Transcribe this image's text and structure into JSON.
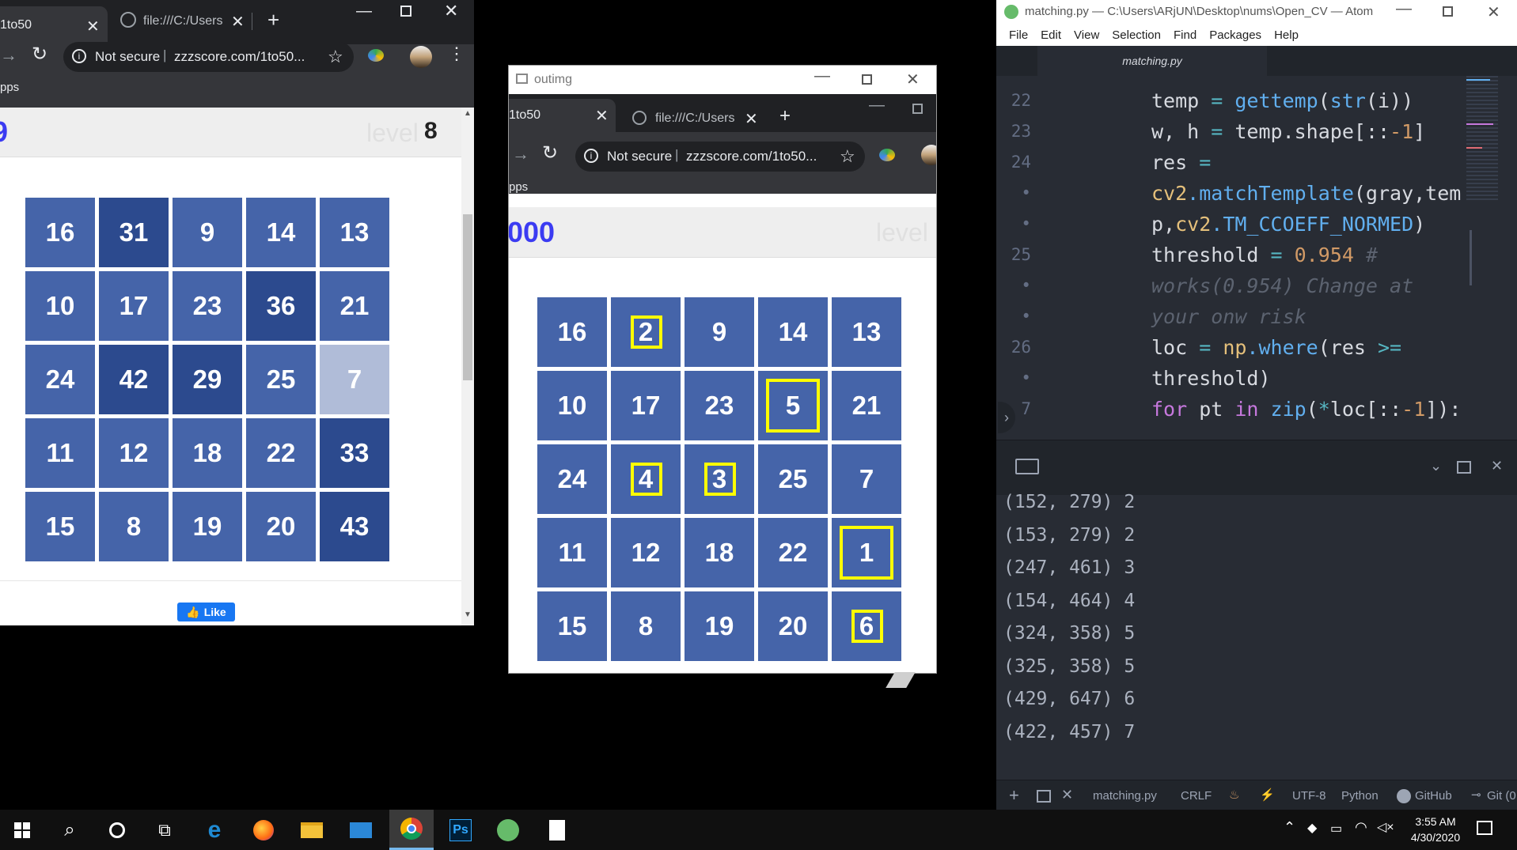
{
  "left_browser": {
    "active_tab": "1to50",
    "inactive_tab": "file:///C:/Users/",
    "new_tab": "+",
    "security": "Not secure",
    "url": "zzzscore.com/1to50...",
    "bookmarks": "pps",
    "score": "9",
    "level_label": "level",
    "level_value": "8",
    "grid": [
      [
        {
          "n": "16",
          "c": "#4564a9"
        },
        {
          "n": "31",
          "c": "#2c4a8e"
        },
        {
          "n": "9",
          "c": "#4564a9"
        },
        {
          "n": "14",
          "c": "#4564a9"
        },
        {
          "n": "13",
          "c": "#4564a9"
        }
      ],
      [
        {
          "n": "10",
          "c": "#4564a9"
        },
        {
          "n": "17",
          "c": "#4564a9"
        },
        {
          "n": "23",
          "c": "#4564a9"
        },
        {
          "n": "36",
          "c": "#2c4a8e"
        },
        {
          "n": "21",
          "c": "#4564a9"
        }
      ],
      [
        {
          "n": "24",
          "c": "#4564a9"
        },
        {
          "n": "42",
          "c": "#2c4a8e"
        },
        {
          "n": "29",
          "c": "#2c4a8e"
        },
        {
          "n": "25",
          "c": "#4564a9"
        },
        {
          "n": "7",
          "c": "#b0bcd8"
        }
      ],
      [
        {
          "n": "11",
          "c": "#4564a9"
        },
        {
          "n": "12",
          "c": "#4564a9"
        },
        {
          "n": "18",
          "c": "#4564a9"
        },
        {
          "n": "22",
          "c": "#4564a9"
        },
        {
          "n": "33",
          "c": "#2c4a8e"
        }
      ],
      [
        {
          "n": "15",
          "c": "#4564a9"
        },
        {
          "n": "8",
          "c": "#4564a9"
        },
        {
          "n": "19",
          "c": "#4564a9"
        },
        {
          "n": "20",
          "c": "#4564a9"
        },
        {
          "n": "43",
          "c": "#2c4a8e"
        }
      ]
    ],
    "like_label": "Like"
  },
  "outimg": {
    "title": "outimg",
    "active_tab": "1to50",
    "inactive_tab": "file:///C:/Users/",
    "new_tab": "+",
    "security": "Not secure",
    "url": "zzzscore.com/1to50...",
    "bookmarks": "pps",
    "score": "000",
    "level_label": "level",
    "grid": [
      [
        {
          "n": "16"
        },
        {
          "n": "2",
          "hl": "small"
        },
        {
          "n": "9"
        },
        {
          "n": "14"
        },
        {
          "n": "13"
        }
      ],
      [
        {
          "n": "10"
        },
        {
          "n": "17"
        },
        {
          "n": "23"
        },
        {
          "n": "5",
          "hl": "big"
        },
        {
          "n": "21"
        }
      ],
      [
        {
          "n": "24"
        },
        {
          "n": "4",
          "hl": "small"
        },
        {
          "n": "3",
          "hl": "small"
        },
        {
          "n": "25"
        },
        {
          "n": "7"
        }
      ],
      [
        {
          "n": "11"
        },
        {
          "n": "12"
        },
        {
          "n": "18"
        },
        {
          "n": "22"
        },
        {
          "n": "1",
          "hl": "big"
        }
      ],
      [
        {
          "n": "15"
        },
        {
          "n": "8"
        },
        {
          "n": "19"
        },
        {
          "n": "20"
        },
        {
          "n": "6",
          "hl": "small"
        }
      ]
    ],
    "cell_color": "#4564a9",
    "highlight_color": "#ffff00"
  },
  "atom": {
    "title": "matching.py — C:\\Users\\ARjUN\\Desktop\\nums\\Open_CV — Atom",
    "menu": [
      "File",
      "Edit",
      "View",
      "Selection",
      "Find",
      "Packages",
      "Help"
    ],
    "tab": "matching.py",
    "code_lines": [
      {
        "ln": "22",
        "parts": [
          [
            "temp",
            "k-var"
          ],
          [
            " = ",
            "k-op"
          ],
          [
            "gettemp",
            "k-fn"
          ],
          [
            "(",
            "k-var"
          ],
          [
            "str",
            "k-fn"
          ],
          [
            "(i))",
            "k-var"
          ]
        ]
      },
      {
        "ln": "23",
        "parts": [
          [
            "w, h",
            "k-var"
          ],
          [
            " = ",
            "k-op"
          ],
          [
            "temp.shape[::",
            "k-var"
          ],
          [
            "-1",
            "k-num"
          ],
          [
            "]",
            "k-var"
          ]
        ]
      },
      {
        "ln": "24",
        "parts": [
          [
            "res",
            "k-var"
          ],
          [
            " =",
            "k-op"
          ]
        ]
      },
      {
        "ln": "•",
        "parts": [
          [
            "cv2",
            "k-mod"
          ],
          [
            ".matchTemplate",
            "k-fn"
          ],
          [
            "(gray,tem",
            "k-var"
          ]
        ]
      },
      {
        "ln": "•",
        "parts": [
          [
            "p,",
            "k-var"
          ],
          [
            "cv2",
            "k-mod"
          ],
          [
            ".TM_CCOEFF_NORMED",
            "k-fn"
          ],
          [
            ")",
            "k-var"
          ]
        ]
      },
      {
        "ln": "25",
        "parts": [
          [
            "threshold",
            "k-var"
          ],
          [
            " = ",
            "k-op"
          ],
          [
            "0.954",
            "k-num"
          ],
          [
            " #",
            "k-cm"
          ]
        ]
      },
      {
        "ln": "•",
        "parts": [
          [
            "works(0.954) Change at",
            "k-cm"
          ]
        ]
      },
      {
        "ln": "•",
        "parts": [
          [
            "your onw risk",
            "k-cm"
          ]
        ]
      },
      {
        "ln": "26",
        "parts": [
          [
            "loc",
            "k-var"
          ],
          [
            " = ",
            "k-op"
          ],
          [
            "np",
            "k-mod"
          ],
          [
            ".where",
            "k-fn"
          ],
          [
            "(res ",
            "k-var"
          ],
          [
            ">=",
            "k-op"
          ]
        ]
      },
      {
        "ln": "•",
        "parts": [
          [
            "threshold)",
            "k-var"
          ]
        ]
      },
      {
        "ln": "7",
        "parts": [
          [
            "for",
            "k-kw"
          ],
          [
            " pt ",
            "k-var"
          ],
          [
            "in",
            "k-kw"
          ],
          [
            " ",
            "k-var"
          ],
          [
            "zip",
            "k-fn"
          ],
          [
            "(",
            "k-var"
          ],
          [
            "*",
            "k-op"
          ],
          [
            "loc[::",
            "k-var"
          ],
          [
            "-1",
            "k-num"
          ],
          [
            "]):",
            "k-var"
          ]
        ]
      }
    ],
    "console": [
      "(152, 279) 2",
      "(153, 279) 2",
      "(247, 461) 3",
      "(154, 464) 4",
      "(324, 358) 5",
      "(325, 358) 5",
      "(429, 647) 6",
      "(422, 457) 7"
    ],
    "status": {
      "file": "matching.py",
      "eol": "CRLF",
      "encoding": "UTF-8",
      "grammar": "Python",
      "github": "GitHub",
      "git": "Git (0"
    }
  },
  "taskbar": {
    "time": "3:55 AM",
    "date": "4/30/2020",
    "ps_label": "Ps"
  }
}
